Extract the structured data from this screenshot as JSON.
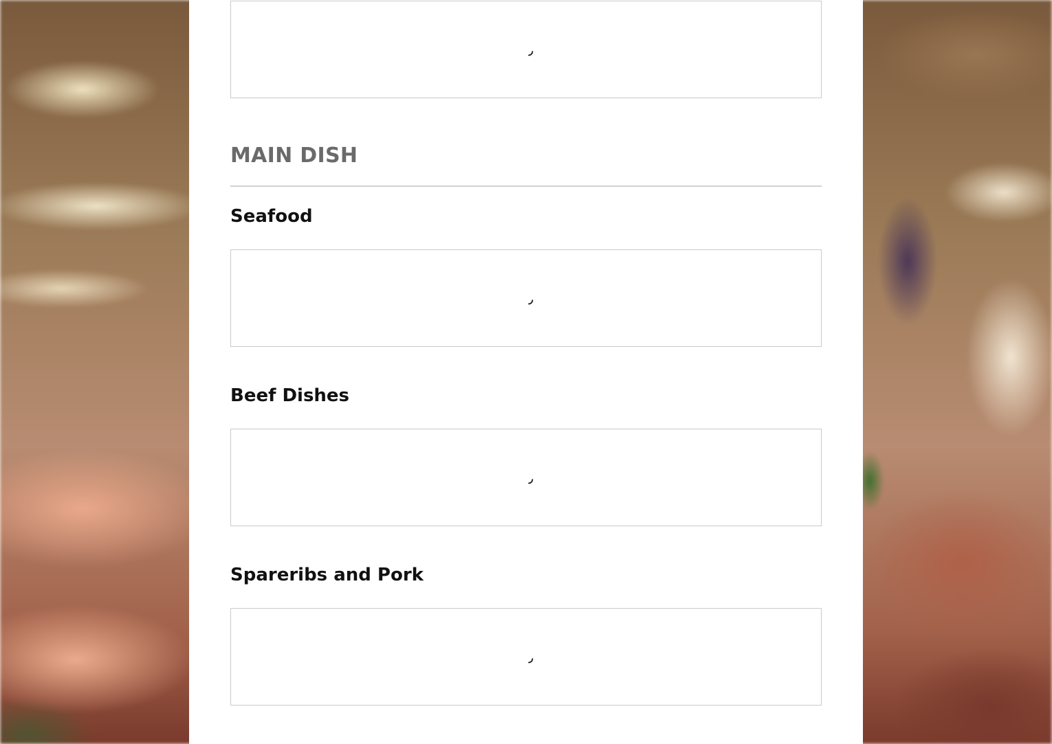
{
  "menu": {
    "section_title": "MAIN DISH",
    "categories": [
      {
        "title": "Seafood"
      },
      {
        "title": "Beef Dishes"
      },
      {
        "title": "Spareribs and Pork"
      }
    ]
  },
  "colors": {
    "section_title": "#6a6a6a",
    "category_title": "#111111",
    "box_border": "#c9c9c9",
    "panel_background": "#ffffff"
  },
  "icons": {
    "loading": "loading-spinner-icon"
  }
}
